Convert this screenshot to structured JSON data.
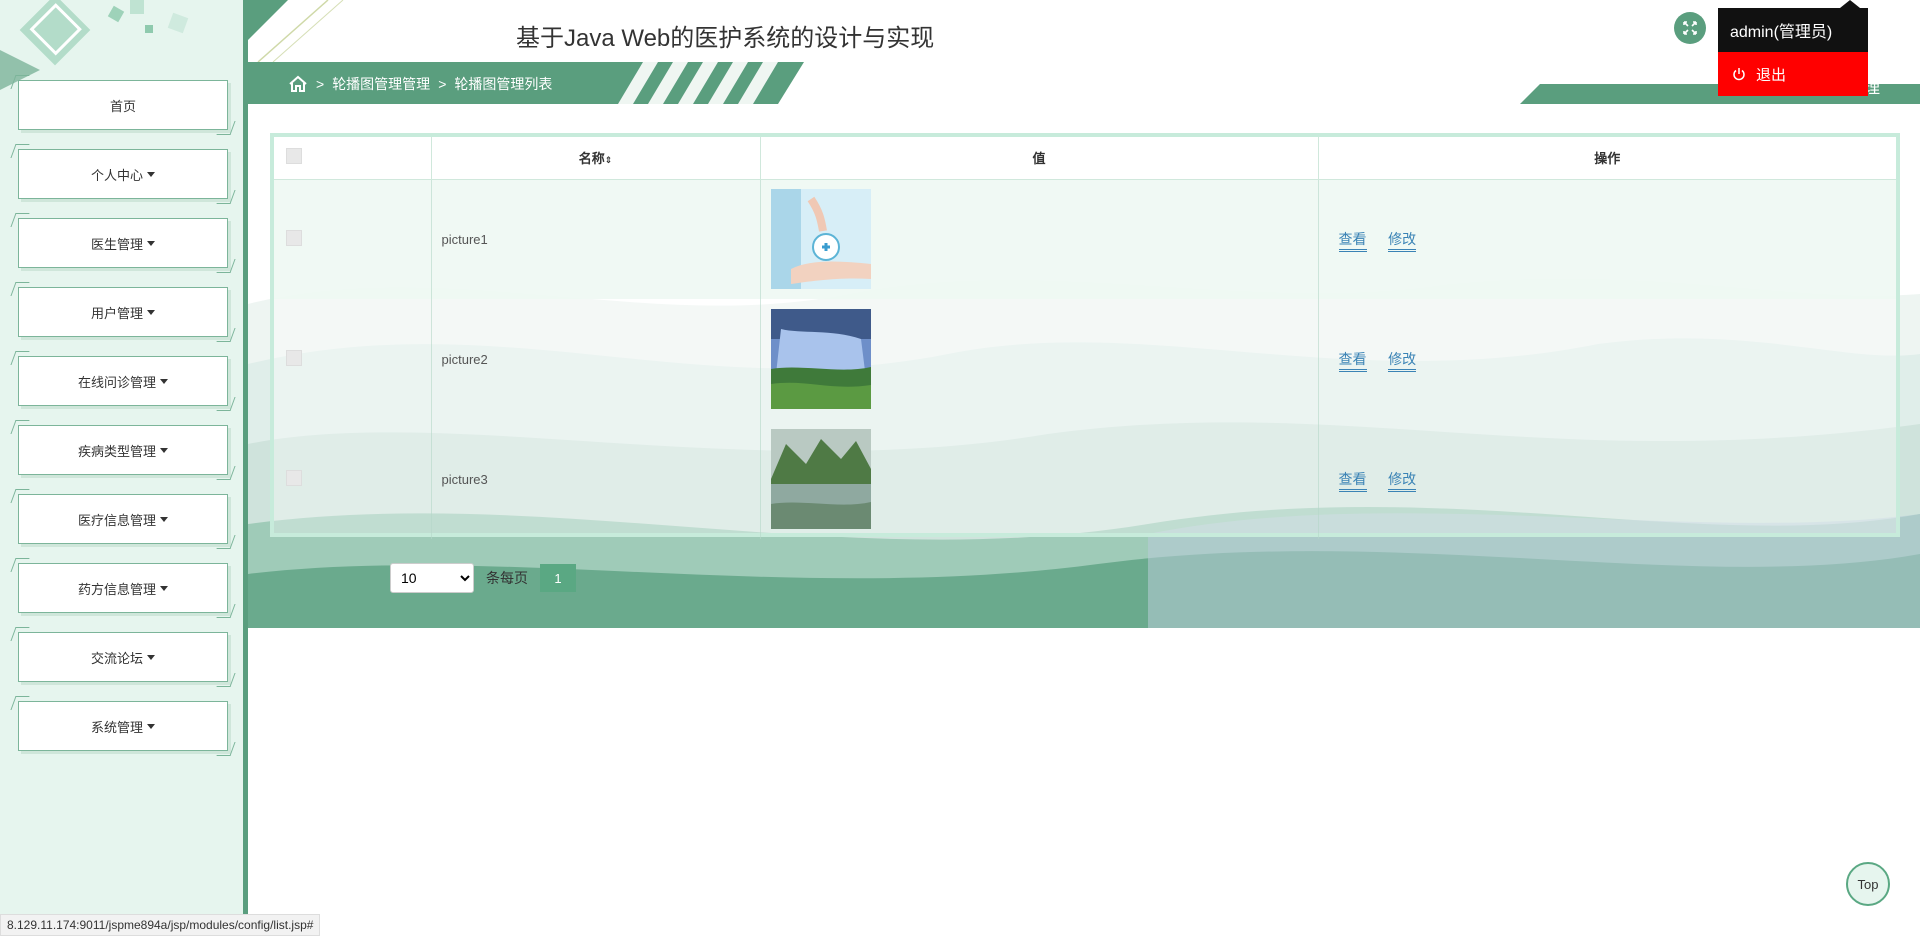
{
  "header": {
    "site_title": "基于Java Web的医护系统的设计与实现",
    "right_bar_text": "理"
  },
  "breadcrumb": {
    "items": [
      "轮播图管理管理",
      "轮播图管理列表"
    ],
    "separator": ">"
  },
  "user_menu": {
    "name": "admin(管理员)",
    "logout_label": "退出"
  },
  "sidebar": {
    "items": [
      {
        "label": "首页",
        "has_caret": false
      },
      {
        "label": "个人中心",
        "has_caret": true
      },
      {
        "label": "医生管理",
        "has_caret": true
      },
      {
        "label": "用户管理",
        "has_caret": true
      },
      {
        "label": "在线问诊管理",
        "has_caret": true
      },
      {
        "label": "疾病类型管理",
        "has_caret": true
      },
      {
        "label": "医疗信息管理",
        "has_caret": true
      },
      {
        "label": "药方信息管理",
        "has_caret": true
      },
      {
        "label": "交流论坛",
        "has_caret": true
      },
      {
        "label": "系统管理",
        "has_caret": true
      }
    ]
  },
  "table": {
    "columns": [
      "名称",
      "值",
      "操作"
    ],
    "rows": [
      {
        "name": "picture1",
        "image": "hand-holding-medical-icon"
      },
      {
        "name": "picture2",
        "image": "waterfall-landscape"
      },
      {
        "name": "picture3",
        "image": "mountain-lake-landscape"
      }
    ],
    "view_label": "查看",
    "edit_label": "修改"
  },
  "pager": {
    "page_size": "10",
    "per_page_label": "条每页",
    "current_page": "1"
  },
  "top_button": "Top",
  "status_url": "8.129.11.174:9011/jspme894a/jsp/modules/config/list.jsp#",
  "colors": {
    "accent": "#5aa883",
    "sidebar_bg": "#e6f5ee",
    "logout_red": "#ff0000",
    "link_blue": "#3a83b5"
  }
}
